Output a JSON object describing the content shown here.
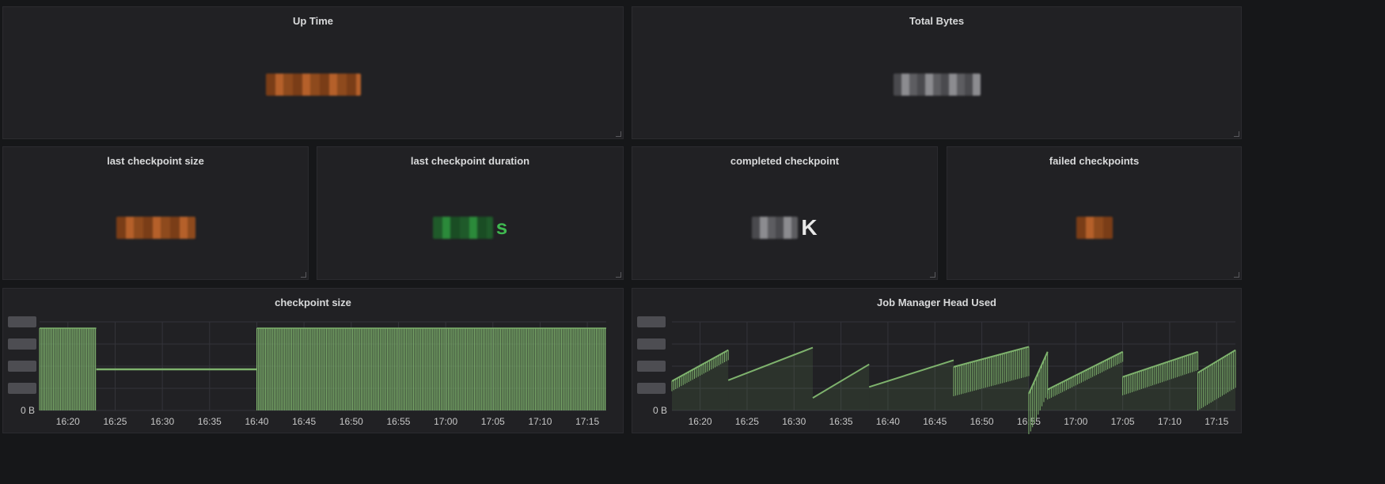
{
  "colors": {
    "background": "#161719",
    "panel": "#212124",
    "series": "#7eb26d",
    "uptime_value": "#b5602a",
    "checkpoint_size_value": "#b5602a",
    "duration_value": "#3fb950",
    "failed_value": "#b5602a"
  },
  "stats": {
    "uptime": {
      "title": "Up Time"
    },
    "total_bytes": {
      "title": "Total Bytes"
    },
    "last_checkpoint_size": {
      "title": "last checkpoint size"
    },
    "last_checkpoint_duration": {
      "title": "last checkpoint duration",
      "unit": "s"
    },
    "completed_checkpoint": {
      "title": "completed checkpoint",
      "unit": "K"
    },
    "failed_checkpoints": {
      "title": "failed checkpoints"
    }
  },
  "charts": {
    "checkpoint_size": {
      "title": "checkpoint size",
      "y_zero_label": "0 B"
    },
    "jm_heap": {
      "title": "Job Manager Head Used",
      "y_zero_label": "0 B"
    }
  },
  "chart_data": [
    {
      "type": "bar",
      "title": "checkpoint size",
      "x_ticks": [
        "16:20",
        "16:25",
        "16:30",
        "16:35",
        "16:40",
        "16:45",
        "16:50",
        "16:55",
        "17:00",
        "17:05",
        "17:10",
        "17:15"
      ],
      "x_range": [
        "16:17",
        "17:17"
      ],
      "y_ticks": [
        "0 B"
      ],
      "grid": true,
      "segments": [
        {
          "from": "16:17",
          "to": "16:23",
          "kind": "dense-bars",
          "level": 1.0
        },
        {
          "from": "16:23",
          "to": "16:40",
          "kind": "flat-line",
          "level": 0.5
        },
        {
          "from": "16:40",
          "to": "17:17",
          "kind": "dense-bars",
          "level": 1.0
        }
      ],
      "series_color": "#7eb26d"
    },
    {
      "type": "area",
      "title": "Job Manager Head Used",
      "x_ticks": [
        "16:20",
        "16:25",
        "16:30",
        "16:35",
        "16:40",
        "16:45",
        "16:50",
        "16:55",
        "17:00",
        "17:05",
        "17:10",
        "17:15"
      ],
      "x_range": [
        "16:17",
        "17:17"
      ],
      "y_ticks": [
        "0 B"
      ],
      "grid": true,
      "segments": [
        {
          "from": "16:17",
          "to": "16:23",
          "start": 0.35,
          "end": 0.72,
          "band": 0.12
        },
        {
          "from": "16:23",
          "to": "16:32",
          "start": 0.36,
          "end": 0.75,
          "band": 0.02
        },
        {
          "from": "16:32",
          "to": "16:38",
          "start": 0.15,
          "end": 0.55,
          "band": 0.02
        },
        {
          "from": "16:38",
          "to": "16:47",
          "start": 0.28,
          "end": 0.6,
          "band": 0.04
        },
        {
          "from": "16:47",
          "to": "16:55",
          "start": 0.52,
          "end": 0.76,
          "band": 0.35
        },
        {
          "from": "16:55",
          "to": "16:57",
          "start": 0.2,
          "end": 0.7,
          "band": 0.5
        },
        {
          "from": "16:57",
          "to": "17:05",
          "start": 0.25,
          "end": 0.7,
          "band": 0.12
        },
        {
          "from": "17:05",
          "to": "17:13",
          "start": 0.4,
          "end": 0.7,
          "band": 0.22
        },
        {
          "from": "17:13",
          "to": "17:17",
          "start": 0.45,
          "end": 0.72,
          "band": 0.45
        }
      ],
      "series_color": "#7eb26d"
    }
  ]
}
